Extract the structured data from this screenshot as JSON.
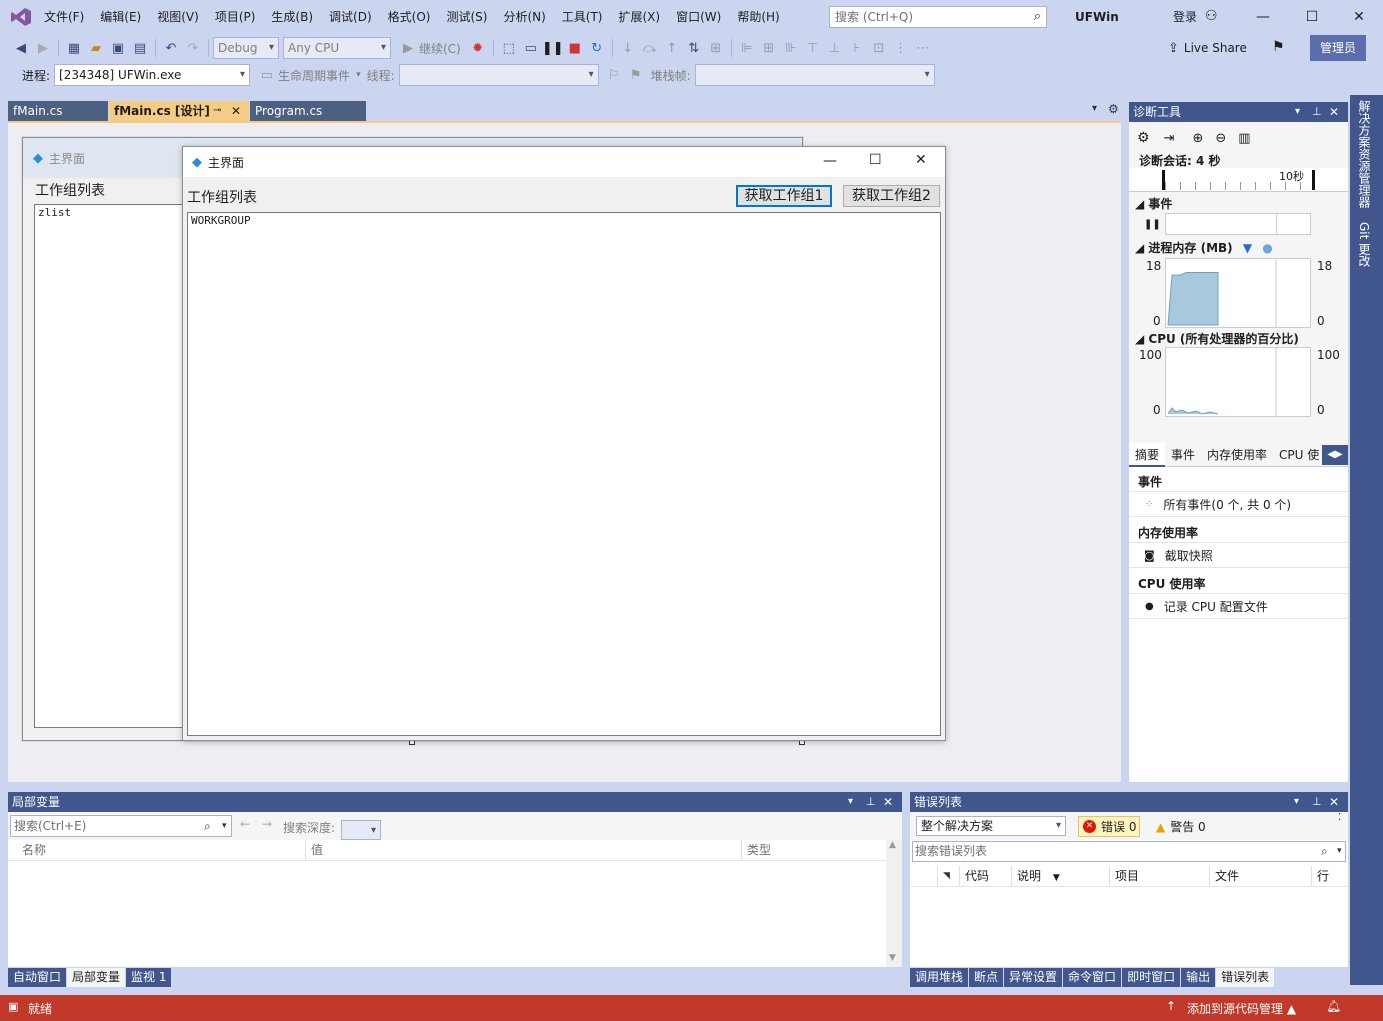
{
  "menu": {
    "items": [
      "文件(F)",
      "编辑(E)",
      "视图(V)",
      "项目(P)",
      "生成(B)",
      "调试(D)",
      "格式(O)",
      "测试(S)",
      "分析(N)",
      "工具(T)",
      "扩展(X)",
      "窗口(W)",
      "帮助(H)"
    ],
    "search_placeholder": "搜索 (Ctrl+Q)",
    "app_name": "UFWin",
    "login": "登录"
  },
  "toolbar": {
    "config": "Debug",
    "platform": "Any CPU",
    "continue": "继续(C)",
    "live_share": "Live Share",
    "admin": "管理员",
    "process_label": "进程:",
    "process_value": "[234348] UFWin.exe",
    "lifecycle": "生命周期事件",
    "thread_label": "线程:",
    "stackframe_label": "堆栈帧:"
  },
  "doc_tabs": [
    {
      "label": "fMain.cs"
    },
    {
      "label": "fMain.cs [设计]"
    },
    {
      "label": "Program.cs"
    }
  ],
  "designer": {
    "bg_form_title": "主界面",
    "bg_label": "工作组列表",
    "bg_list_item": "zlist",
    "form_title": "主界面",
    "label": "工作组列表",
    "btn1": "获取工作组1",
    "btn2": "获取工作组2",
    "list_item": "WORKGROUP"
  },
  "diagnostics": {
    "title": "诊断工具",
    "session": "诊断会话: 4 秒",
    "timeline_label": "10秒",
    "events_header": "事件",
    "memory_header": "进程内存 (MB)",
    "memory_max": "18",
    "memory_min": "0",
    "cpu_header": "CPU (所有处理器的百分比)",
    "cpu_max": "100",
    "cpu_min": "0",
    "tabs": [
      "摘要",
      "事件",
      "内存使用率",
      "CPU 使"
    ],
    "summary_events_title": "事件",
    "summary_events_item": "所有事件(0 个, 共 0 个)",
    "summary_memory_title": "内存使用率",
    "summary_memory_item": "截取快照",
    "summary_cpu_title": "CPU 使用率",
    "summary_cpu_item": "记录 CPU 配置文件",
    "memory_chart": [
      0,
      0.78,
      0.78,
      0.82,
      0.82
    ]
  },
  "side_tabs": [
    "解决方案资源管理器",
    "Git 更改"
  ],
  "locals": {
    "title": "局部变量",
    "search_placeholder": "搜索(Ctrl+E)",
    "search_depth": "搜索深度:",
    "columns": [
      "名称",
      "值",
      "类型"
    ],
    "tabs": [
      "自动窗口",
      "局部变量",
      "监视 1"
    ]
  },
  "errors": {
    "title": "错误列表",
    "scope": "整个解决方案",
    "errors_label": "错误 0",
    "warnings_label": "警告 0",
    "search_placeholder": "搜索错误列表",
    "columns": [
      "代码",
      "说明",
      "项目",
      "文件",
      "行"
    ],
    "tabs": [
      "调用堆栈",
      "断点",
      "异常设置",
      "命令窗口",
      "即时窗口",
      "输出",
      "错误列表"
    ]
  },
  "status": {
    "ready": "就绪",
    "source_control": "添加到源代码管理"
  }
}
